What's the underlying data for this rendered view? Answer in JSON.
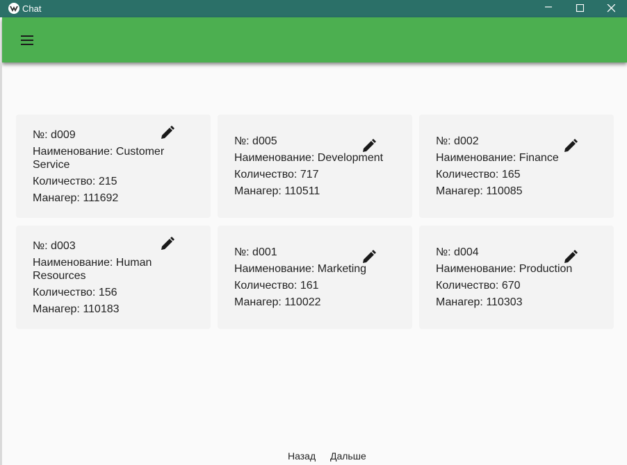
{
  "window": {
    "title": "Chat",
    "accent_color": "#2b7068",
    "controls": [
      "minimize-icon",
      "maximize-icon",
      "close-icon"
    ]
  },
  "appbar": {
    "color": "#4caf50",
    "menu_icon": "hamburger-menu-icon"
  },
  "cards": [
    {
      "number": "№: d009",
      "name": "Наименование: Customer Service",
      "count": "Количество: 215",
      "manager": "Манагер: 111692"
    },
    {
      "number": "№: d005",
      "name": "Наименование: Development",
      "count": "Количество: 717",
      "manager": "Манагер: 110511"
    },
    {
      "number": "№: d002",
      "name": "Наименование: Finance",
      "count": "Количество: 165",
      "manager": "Манагер: 110085"
    },
    {
      "number": "№: d003",
      "name": "Наименование: Human Resources",
      "count": "Количество: 156",
      "manager": "Манагер: 110183"
    },
    {
      "number": "№: d001",
      "name": "Наименование: Marketing",
      "count": "Количество: 161",
      "manager": "Манагер: 110022"
    },
    {
      "number": "№: d004",
      "name": "Наименование: Production",
      "count": "Количество: 670",
      "manager": "Манагер: 110303"
    }
  ],
  "pagination": {
    "back_label": "Назад",
    "next_label": "Дальше"
  }
}
